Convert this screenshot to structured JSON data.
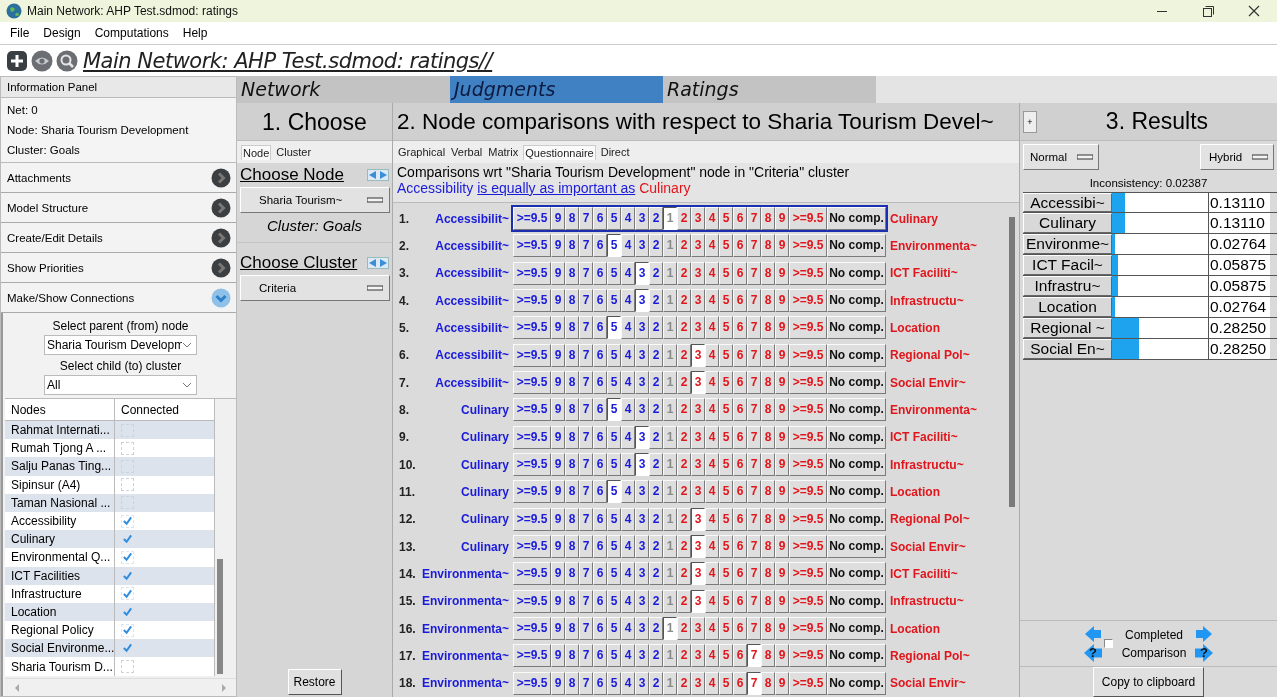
{
  "window": {
    "title": "Main Network: AHP Test.sdmod: ratings"
  },
  "menu": [
    "File",
    "Design",
    "Computations",
    "Help"
  ],
  "toolbar": {
    "title": "Main Network: AHP Test.sdmod: ratings//"
  },
  "info_panel": {
    "header": "Information Panel",
    "lines": [
      "Net: 0",
      "Node: Sharia Tourism Development",
      "Cluster: Goals"
    ]
  },
  "accordion": [
    {
      "label": "Attachments",
      "expanded": false
    },
    {
      "label": "Model Structure",
      "expanded": false
    },
    {
      "label": "Create/Edit Details",
      "expanded": false
    },
    {
      "label": "Show Priorities",
      "expanded": false
    },
    {
      "label": "Make/Show Connections",
      "expanded": true
    }
  ],
  "connections": {
    "parent_label": "Select parent (from) node",
    "parent_value": "Sharia Tourism Developm",
    "child_label": "Select child (to) cluster",
    "child_value": "All",
    "columns": [
      "Nodes",
      "Connected"
    ],
    "rows": [
      {
        "name": "Rahmat Internati...",
        "checked": false
      },
      {
        "name": "Rumah Tjong A ...",
        "checked": false
      },
      {
        "name": "Salju Panas Ting...",
        "checked": false
      },
      {
        "name": "Sipinsur (A4)",
        "checked": false
      },
      {
        "name": "Taman Nasional ...",
        "checked": false
      },
      {
        "name": "Accessibility",
        "checked": true
      },
      {
        "name": "Culinary",
        "checked": true
      },
      {
        "name": "Environmental Q...",
        "checked": true
      },
      {
        "name": "ICT Facilities",
        "checked": true
      },
      {
        "name": "Infrastructure",
        "checked": true
      },
      {
        "name": "Location",
        "checked": true
      },
      {
        "name": "Regional Policy",
        "checked": true
      },
      {
        "name": "Social Environme...",
        "checked": true
      },
      {
        "name": "Sharia Tourism D...",
        "checked": false
      }
    ]
  },
  "tabs": [
    {
      "label": "Network",
      "selected": false
    },
    {
      "label": "Judgments",
      "selected": true
    },
    {
      "label": "Ratings",
      "selected": false
    }
  ],
  "choose": {
    "title": "1. Choose",
    "subtabs": [
      {
        "label": "Node",
        "selected": true
      },
      {
        "label": "Cluster",
        "selected": false
      }
    ],
    "node_heading": "Choose Node",
    "node_value": "Sharia Tourism~",
    "cluster_caption": "Cluster: Goals",
    "cluster_heading": "Choose Cluster",
    "cluster_value": "Criteria",
    "restore": "Restore"
  },
  "comparisons": {
    "title": "2. Node comparisons with respect to Sharia Tourism Devel~",
    "modes": [
      {
        "label": "Graphical",
        "selected": false
      },
      {
        "label": "Verbal",
        "selected": false
      },
      {
        "label": "Matrix",
        "selected": false
      },
      {
        "label": "Questionnaire",
        "selected": true
      },
      {
        "label": "Direct",
        "selected": false
      }
    ],
    "wrt_text": "Comparisons wrt \"Sharia Tourism Development\" node in \"Criteria\" cluster",
    "verdict": {
      "left": "Accessibility",
      "phrase": "is equally as important as",
      "right": "Culinary"
    },
    "rows": [
      {
        "number": "1.",
        "left": "Accessibilit~",
        "right": "Culinary",
        "focused": true,
        "cells": [
          {
            "label": ">=9.5",
            "selected": false
          },
          {
            "label": "9",
            "selected": false
          },
          {
            "label": "8",
            "selected": false
          },
          {
            "label": "7",
            "selected": false
          },
          {
            "label": "6",
            "selected": false
          },
          {
            "label": "5",
            "selected": false
          },
          {
            "label": "4",
            "selected": false
          },
          {
            "label": "3",
            "selected": false
          },
          {
            "label": "2",
            "selected": false
          },
          {
            "label": "1",
            "selected": true
          },
          {
            "label": "2",
            "selected": false
          },
          {
            "label": "3",
            "selected": false
          },
          {
            "label": "4",
            "selected": false
          },
          {
            "label": "5",
            "selected": false
          },
          {
            "label": "6",
            "selected": false
          },
          {
            "label": "7",
            "selected": false
          },
          {
            "label": "8",
            "selected": false
          },
          {
            "label": "9",
            "selected": false
          },
          {
            "label": ">=9.5",
            "selected": false
          },
          {
            "label": "No comp.",
            "selected": false
          }
        ]
      },
      {
        "number": "2.",
        "left": "Accessibilit~",
        "right": "Environmenta~",
        "focused": false,
        "cells": [
          {
            "label": ">=9.5",
            "selected": false
          },
          {
            "label": "9",
            "selected": false
          },
          {
            "label": "8",
            "selected": false
          },
          {
            "label": "7",
            "selected": false
          },
          {
            "label": "6",
            "selected": false
          },
          {
            "label": "5",
            "selected": true
          },
          {
            "label": "4",
            "selected": false
          },
          {
            "label": "3",
            "selected": false
          },
          {
            "label": "2",
            "selected": false
          },
          {
            "label": "1",
            "selected": false
          },
          {
            "label": "2",
            "selected": false
          },
          {
            "label": "3",
            "selected": false
          },
          {
            "label": "4",
            "selected": false
          },
          {
            "label": "5",
            "selected": false
          },
          {
            "label": "6",
            "selected": false
          },
          {
            "label": "7",
            "selected": false
          },
          {
            "label": "8",
            "selected": false
          },
          {
            "label": "9",
            "selected": false
          },
          {
            "label": ">=9.5",
            "selected": false
          },
          {
            "label": "No comp.",
            "selected": false
          }
        ]
      },
      {
        "number": "3.",
        "left": "Accessibilit~",
        "right": "ICT Faciliti~",
        "focused": false,
        "cells": [
          {
            "label": ">=9.5",
            "selected": false
          },
          {
            "label": "9",
            "selected": false
          },
          {
            "label": "8",
            "selected": false
          },
          {
            "label": "7",
            "selected": false
          },
          {
            "label": "6",
            "selected": false
          },
          {
            "label": "5",
            "selected": false
          },
          {
            "label": "4",
            "selected": false
          },
          {
            "label": "3",
            "selected": true
          },
          {
            "label": "2",
            "selected": false
          },
          {
            "label": "1",
            "selected": false
          },
          {
            "label": "2",
            "selected": false
          },
          {
            "label": "3",
            "selected": false
          },
          {
            "label": "4",
            "selected": false
          },
          {
            "label": "5",
            "selected": false
          },
          {
            "label": "6",
            "selected": false
          },
          {
            "label": "7",
            "selected": false
          },
          {
            "label": "8",
            "selected": false
          },
          {
            "label": "9",
            "selected": false
          },
          {
            "label": ">=9.5",
            "selected": false
          },
          {
            "label": "No comp.",
            "selected": false
          }
        ]
      },
      {
        "number": "4.",
        "left": "Accessibilit~",
        "right": "Infrastructu~",
        "focused": false,
        "cells": [
          {
            "label": ">=9.5",
            "selected": false
          },
          {
            "label": "9",
            "selected": false
          },
          {
            "label": "8",
            "selected": false
          },
          {
            "label": "7",
            "selected": false
          },
          {
            "label": "6",
            "selected": false
          },
          {
            "label": "5",
            "selected": false
          },
          {
            "label": "4",
            "selected": false
          },
          {
            "label": "3",
            "selected": true
          },
          {
            "label": "2",
            "selected": false
          },
          {
            "label": "1",
            "selected": false
          },
          {
            "label": "2",
            "selected": false
          },
          {
            "label": "3",
            "selected": false
          },
          {
            "label": "4",
            "selected": false
          },
          {
            "label": "5",
            "selected": false
          },
          {
            "label": "6",
            "selected": false
          },
          {
            "label": "7",
            "selected": false
          },
          {
            "label": "8",
            "selected": false
          },
          {
            "label": "9",
            "selected": false
          },
          {
            "label": ">=9.5",
            "selected": false
          },
          {
            "label": "No comp.",
            "selected": false
          }
        ]
      },
      {
        "number": "5.",
        "left": "Accessibilit~",
        "right": "Location",
        "focused": false,
        "cells": [
          {
            "label": ">=9.5",
            "selected": false
          },
          {
            "label": "9",
            "selected": false
          },
          {
            "label": "8",
            "selected": false
          },
          {
            "label": "7",
            "selected": false
          },
          {
            "label": "6",
            "selected": false
          },
          {
            "label": "5",
            "selected": true
          },
          {
            "label": "4",
            "selected": false
          },
          {
            "label": "3",
            "selected": false
          },
          {
            "label": "2",
            "selected": false
          },
          {
            "label": "1",
            "selected": false
          },
          {
            "label": "2",
            "selected": false
          },
          {
            "label": "3",
            "selected": false
          },
          {
            "label": "4",
            "selected": false
          },
          {
            "label": "5",
            "selected": false
          },
          {
            "label": "6",
            "selected": false
          },
          {
            "label": "7",
            "selected": false
          },
          {
            "label": "8",
            "selected": false
          },
          {
            "label": "9",
            "selected": false
          },
          {
            "label": ">=9.5",
            "selected": false
          },
          {
            "label": "No comp.",
            "selected": false
          }
        ]
      },
      {
        "number": "6.",
        "left": "Accessibilit~",
        "right": "Regional Pol~",
        "focused": false,
        "cells": [
          {
            "label": ">=9.5",
            "selected": false
          },
          {
            "label": "9",
            "selected": false
          },
          {
            "label": "8",
            "selected": false
          },
          {
            "label": "7",
            "selected": false
          },
          {
            "label": "6",
            "selected": false
          },
          {
            "label": "5",
            "selected": false
          },
          {
            "label": "4",
            "selected": false
          },
          {
            "label": "3",
            "selected": false
          },
          {
            "label": "2",
            "selected": false
          },
          {
            "label": "1",
            "selected": false
          },
          {
            "label": "2",
            "selected": false
          },
          {
            "label": "3",
            "selected": true
          },
          {
            "label": "4",
            "selected": false
          },
          {
            "label": "5",
            "selected": false
          },
          {
            "label": "6",
            "selected": false
          },
          {
            "label": "7",
            "selected": false
          },
          {
            "label": "8",
            "selected": false
          },
          {
            "label": "9",
            "selected": false
          },
          {
            "label": ">=9.5",
            "selected": false
          },
          {
            "label": "No comp.",
            "selected": false
          }
        ]
      },
      {
        "number": "7.",
        "left": "Accessibilit~",
        "right": "Social Envir~",
        "focused": false,
        "cells": [
          {
            "label": ">=9.5",
            "selected": false
          },
          {
            "label": "9",
            "selected": false
          },
          {
            "label": "8",
            "selected": false
          },
          {
            "label": "7",
            "selected": false
          },
          {
            "label": "6",
            "selected": false
          },
          {
            "label": "5",
            "selected": false
          },
          {
            "label": "4",
            "selected": false
          },
          {
            "label": "3",
            "selected": false
          },
          {
            "label": "2",
            "selected": false
          },
          {
            "label": "1",
            "selected": false
          },
          {
            "label": "2",
            "selected": false
          },
          {
            "label": "3",
            "selected": true
          },
          {
            "label": "4",
            "selected": false
          },
          {
            "label": "5",
            "selected": false
          },
          {
            "label": "6",
            "selected": false
          },
          {
            "label": "7",
            "selected": false
          },
          {
            "label": "8",
            "selected": false
          },
          {
            "label": "9",
            "selected": false
          },
          {
            "label": ">=9.5",
            "selected": false
          },
          {
            "label": "No comp.",
            "selected": false
          }
        ]
      },
      {
        "number": "8.",
        "left": "Culinary",
        "right": "Environmenta~",
        "focused": false,
        "cells": [
          {
            "label": ">=9.5",
            "selected": false
          },
          {
            "label": "9",
            "selected": false
          },
          {
            "label": "8",
            "selected": false
          },
          {
            "label": "7",
            "selected": false
          },
          {
            "label": "6",
            "selected": false
          },
          {
            "label": "5",
            "selected": true
          },
          {
            "label": "4",
            "selected": false
          },
          {
            "label": "3",
            "selected": false
          },
          {
            "label": "2",
            "selected": false
          },
          {
            "label": "1",
            "selected": false
          },
          {
            "label": "2",
            "selected": false
          },
          {
            "label": "3",
            "selected": false
          },
          {
            "label": "4",
            "selected": false
          },
          {
            "label": "5",
            "selected": false
          },
          {
            "label": "6",
            "selected": false
          },
          {
            "label": "7",
            "selected": false
          },
          {
            "label": "8",
            "selected": false
          },
          {
            "label": "9",
            "selected": false
          },
          {
            "label": ">=9.5",
            "selected": false
          },
          {
            "label": "No comp.",
            "selected": false
          }
        ]
      },
      {
        "number": "9.",
        "left": "Culinary",
        "right": "ICT Faciliti~",
        "focused": false,
        "cells": [
          {
            "label": ">=9.5",
            "selected": false
          },
          {
            "label": "9",
            "selected": false
          },
          {
            "label": "8",
            "selected": false
          },
          {
            "label": "7",
            "selected": false
          },
          {
            "label": "6",
            "selected": false
          },
          {
            "label": "5",
            "selected": false
          },
          {
            "label": "4",
            "selected": false
          },
          {
            "label": "3",
            "selected": true
          },
          {
            "label": "2",
            "selected": false
          },
          {
            "label": "1",
            "selected": false
          },
          {
            "label": "2",
            "selected": false
          },
          {
            "label": "3",
            "selected": false
          },
          {
            "label": "4",
            "selected": false
          },
          {
            "label": "5",
            "selected": false
          },
          {
            "label": "6",
            "selected": false
          },
          {
            "label": "7",
            "selected": false
          },
          {
            "label": "8",
            "selected": false
          },
          {
            "label": "9",
            "selected": false
          },
          {
            "label": ">=9.5",
            "selected": false
          },
          {
            "label": "No comp.",
            "selected": false
          }
        ]
      },
      {
        "number": "10.",
        "left": "Culinary",
        "right": "Infrastructu~",
        "focused": false,
        "cells": [
          {
            "label": ">=9.5",
            "selected": false
          },
          {
            "label": "9",
            "selected": false
          },
          {
            "label": "8",
            "selected": false
          },
          {
            "label": "7",
            "selected": false
          },
          {
            "label": "6",
            "selected": false
          },
          {
            "label": "5",
            "selected": false
          },
          {
            "label": "4",
            "selected": false
          },
          {
            "label": "3",
            "selected": true
          },
          {
            "label": "2",
            "selected": false
          },
          {
            "label": "1",
            "selected": false
          },
          {
            "label": "2",
            "selected": false
          },
          {
            "label": "3",
            "selected": false
          },
          {
            "label": "4",
            "selected": false
          },
          {
            "label": "5",
            "selected": false
          },
          {
            "label": "6",
            "selected": false
          },
          {
            "label": "7",
            "selected": false
          },
          {
            "label": "8",
            "selected": false
          },
          {
            "label": "9",
            "selected": false
          },
          {
            "label": ">=9.5",
            "selected": false
          },
          {
            "label": "No comp.",
            "selected": false
          }
        ]
      },
      {
        "number": "11.",
        "left": "Culinary",
        "right": "Location",
        "focused": false,
        "cells": [
          {
            "label": ">=9.5",
            "selected": false
          },
          {
            "label": "9",
            "selected": false
          },
          {
            "label": "8",
            "selected": false
          },
          {
            "label": "7",
            "selected": false
          },
          {
            "label": "6",
            "selected": false
          },
          {
            "label": "5",
            "selected": true
          },
          {
            "label": "4",
            "selected": false
          },
          {
            "label": "3",
            "selected": false
          },
          {
            "label": "2",
            "selected": false
          },
          {
            "label": "1",
            "selected": false
          },
          {
            "label": "2",
            "selected": false
          },
          {
            "label": "3",
            "selected": false
          },
          {
            "label": "4",
            "selected": false
          },
          {
            "label": "5",
            "selected": false
          },
          {
            "label": "6",
            "selected": false
          },
          {
            "label": "7",
            "selected": false
          },
          {
            "label": "8",
            "selected": false
          },
          {
            "label": "9",
            "selected": false
          },
          {
            "label": ">=9.5",
            "selected": false
          },
          {
            "label": "No comp.",
            "selected": false
          }
        ]
      },
      {
        "number": "12.",
        "left": "Culinary",
        "right": "Regional Pol~",
        "focused": false,
        "cells": [
          {
            "label": ">=9.5",
            "selected": false
          },
          {
            "label": "9",
            "selected": false
          },
          {
            "label": "8",
            "selected": false
          },
          {
            "label": "7",
            "selected": false
          },
          {
            "label": "6",
            "selected": false
          },
          {
            "label": "5",
            "selected": false
          },
          {
            "label": "4",
            "selected": false
          },
          {
            "label": "3",
            "selected": false
          },
          {
            "label": "2",
            "selected": false
          },
          {
            "label": "1",
            "selected": false
          },
          {
            "label": "2",
            "selected": false
          },
          {
            "label": "3",
            "selected": true
          },
          {
            "label": "4",
            "selected": false
          },
          {
            "label": "5",
            "selected": false
          },
          {
            "label": "6",
            "selected": false
          },
          {
            "label": "7",
            "selected": false
          },
          {
            "label": "8",
            "selected": false
          },
          {
            "label": "9",
            "selected": false
          },
          {
            "label": ">=9.5",
            "selected": false
          },
          {
            "label": "No comp.",
            "selected": false
          }
        ]
      },
      {
        "number": "13.",
        "left": "Culinary",
        "right": "Social Envir~",
        "focused": false,
        "cells": [
          {
            "label": ">=9.5",
            "selected": false
          },
          {
            "label": "9",
            "selected": false
          },
          {
            "label": "8",
            "selected": false
          },
          {
            "label": "7",
            "selected": false
          },
          {
            "label": "6",
            "selected": false
          },
          {
            "label": "5",
            "selected": false
          },
          {
            "label": "4",
            "selected": false
          },
          {
            "label": "3",
            "selected": false
          },
          {
            "label": "2",
            "selected": false
          },
          {
            "label": "1",
            "selected": false
          },
          {
            "label": "2",
            "selected": false
          },
          {
            "label": "3",
            "selected": true
          },
          {
            "label": "4",
            "selected": false
          },
          {
            "label": "5",
            "selected": false
          },
          {
            "label": "6",
            "selected": false
          },
          {
            "label": "7",
            "selected": false
          },
          {
            "label": "8",
            "selected": false
          },
          {
            "label": "9",
            "selected": false
          },
          {
            "label": ">=9.5",
            "selected": false
          },
          {
            "label": "No comp.",
            "selected": false
          }
        ]
      },
      {
        "number": "14.",
        "left": "Environmenta~",
        "right": "ICT Faciliti~",
        "focused": false,
        "cells": [
          {
            "label": ">=9.5",
            "selected": false
          },
          {
            "label": "9",
            "selected": false
          },
          {
            "label": "8",
            "selected": false
          },
          {
            "label": "7",
            "selected": false
          },
          {
            "label": "6",
            "selected": false
          },
          {
            "label": "5",
            "selected": false
          },
          {
            "label": "4",
            "selected": false
          },
          {
            "label": "3",
            "selected": false
          },
          {
            "label": "2",
            "selected": false
          },
          {
            "label": "1",
            "selected": false
          },
          {
            "label": "2",
            "selected": false
          },
          {
            "label": "3",
            "selected": true
          },
          {
            "label": "4",
            "selected": false
          },
          {
            "label": "5",
            "selected": false
          },
          {
            "label": "6",
            "selected": false
          },
          {
            "label": "7",
            "selected": false
          },
          {
            "label": "8",
            "selected": false
          },
          {
            "label": "9",
            "selected": false
          },
          {
            "label": ">=9.5",
            "selected": false
          },
          {
            "label": "No comp.",
            "selected": false
          }
        ]
      },
      {
        "number": "15.",
        "left": "Environmenta~",
        "right": "Infrastructu~",
        "focused": false,
        "cells": [
          {
            "label": ">=9.5",
            "selected": false
          },
          {
            "label": "9",
            "selected": false
          },
          {
            "label": "8",
            "selected": false
          },
          {
            "label": "7",
            "selected": false
          },
          {
            "label": "6",
            "selected": false
          },
          {
            "label": "5",
            "selected": false
          },
          {
            "label": "4",
            "selected": false
          },
          {
            "label": "3",
            "selected": false
          },
          {
            "label": "2",
            "selected": false
          },
          {
            "label": "1",
            "selected": false
          },
          {
            "label": "2",
            "selected": false
          },
          {
            "label": "3",
            "selected": true
          },
          {
            "label": "4",
            "selected": false
          },
          {
            "label": "5",
            "selected": false
          },
          {
            "label": "6",
            "selected": false
          },
          {
            "label": "7",
            "selected": false
          },
          {
            "label": "8",
            "selected": false
          },
          {
            "label": "9",
            "selected": false
          },
          {
            "label": ">=9.5",
            "selected": false
          },
          {
            "label": "No comp.",
            "selected": false
          }
        ]
      },
      {
        "number": "16.",
        "left": "Environmenta~",
        "right": "Location",
        "focused": false,
        "cells": [
          {
            "label": ">=9.5",
            "selected": false
          },
          {
            "label": "9",
            "selected": false
          },
          {
            "label": "8",
            "selected": false
          },
          {
            "label": "7",
            "selected": false
          },
          {
            "label": "6",
            "selected": false
          },
          {
            "label": "5",
            "selected": false
          },
          {
            "label": "4",
            "selected": false
          },
          {
            "label": "3",
            "selected": false
          },
          {
            "label": "2",
            "selected": false
          },
          {
            "label": "1",
            "selected": true
          },
          {
            "label": "2",
            "selected": false
          },
          {
            "label": "3",
            "selected": false
          },
          {
            "label": "4",
            "selected": false
          },
          {
            "label": "5",
            "selected": false
          },
          {
            "label": "6",
            "selected": false
          },
          {
            "label": "7",
            "selected": false
          },
          {
            "label": "8",
            "selected": false
          },
          {
            "label": "9",
            "selected": false
          },
          {
            "label": ">=9.5",
            "selected": false
          },
          {
            "label": "No comp.",
            "selected": false
          }
        ]
      },
      {
        "number": "17.",
        "left": "Environmenta~",
        "right": "Regional Pol~",
        "focused": false,
        "cells": [
          {
            "label": ">=9.5",
            "selected": false
          },
          {
            "label": "9",
            "selected": false
          },
          {
            "label": "8",
            "selected": false
          },
          {
            "label": "7",
            "selected": false
          },
          {
            "label": "6",
            "selected": false
          },
          {
            "label": "5",
            "selected": false
          },
          {
            "label": "4",
            "selected": false
          },
          {
            "label": "3",
            "selected": false
          },
          {
            "label": "2",
            "selected": false
          },
          {
            "label": "1",
            "selected": false
          },
          {
            "label": "2",
            "selected": false
          },
          {
            "label": "3",
            "selected": false
          },
          {
            "label": "4",
            "selected": false
          },
          {
            "label": "5",
            "selected": false
          },
          {
            "label": "6",
            "selected": false
          },
          {
            "label": "7",
            "selected": true
          },
          {
            "label": "8",
            "selected": false
          },
          {
            "label": "9",
            "selected": false
          },
          {
            "label": ">=9.5",
            "selected": false
          },
          {
            "label": "No comp.",
            "selected": false
          }
        ]
      },
      {
        "number": "18.",
        "left": "Environmenta~",
        "right": "Social Envir~",
        "focused": false,
        "cells": [
          {
            "label": ">=9.5",
            "selected": false
          },
          {
            "label": "9",
            "selected": false
          },
          {
            "label": "8",
            "selected": false
          },
          {
            "label": "7",
            "selected": false
          },
          {
            "label": "6",
            "selected": false
          },
          {
            "label": "5",
            "selected": false
          },
          {
            "label": "4",
            "selected": false
          },
          {
            "label": "3",
            "selected": false
          },
          {
            "label": "2",
            "selected": false
          },
          {
            "label": "1",
            "selected": false
          },
          {
            "label": "2",
            "selected": false
          },
          {
            "label": "3",
            "selected": false
          },
          {
            "label": "4",
            "selected": false
          },
          {
            "label": "5",
            "selected": false
          },
          {
            "label": "6",
            "selected": false
          },
          {
            "label": "7",
            "selected": true
          },
          {
            "label": "8",
            "selected": false
          },
          {
            "label": "9",
            "selected": false
          },
          {
            "label": ">=9.5",
            "selected": false
          },
          {
            "label": "No comp.",
            "selected": false
          }
        ]
      }
    ]
  },
  "results": {
    "plus": "+",
    "title": "3. Results",
    "normalization": "Normal",
    "mode": "Hybrid",
    "inconsistency": "Inconsistency: 0.02387",
    "rows": [
      {
        "name": "Accessibi~",
        "level": 0.1311,
        "value": "0.13110"
      },
      {
        "name": "Culinary",
        "level": 0.1311,
        "value": "0.13110"
      },
      {
        "name": "Environme~",
        "level": 0.02764,
        "value": "0.02764"
      },
      {
        "name": "ICT Facil~",
        "level": 0.05875,
        "value": "0.05875"
      },
      {
        "name": "Infrastru~",
        "level": 0.05875,
        "value": "0.05875"
      },
      {
        "name": "Location",
        "level": 0.02764,
        "value": "0.02764"
      },
      {
        "name": "Regional ~",
        "level": 0.2825,
        "value": "0.28250"
      },
      {
        "name": "Social En~",
        "level": 0.2825,
        "value": "0.28250"
      }
    ],
    "nav": {
      "completed": false,
      "label": "Completed Comparison",
      "prev_help": "?",
      "next_help": "?"
    },
    "copy": "Copy to clipboard"
  }
}
